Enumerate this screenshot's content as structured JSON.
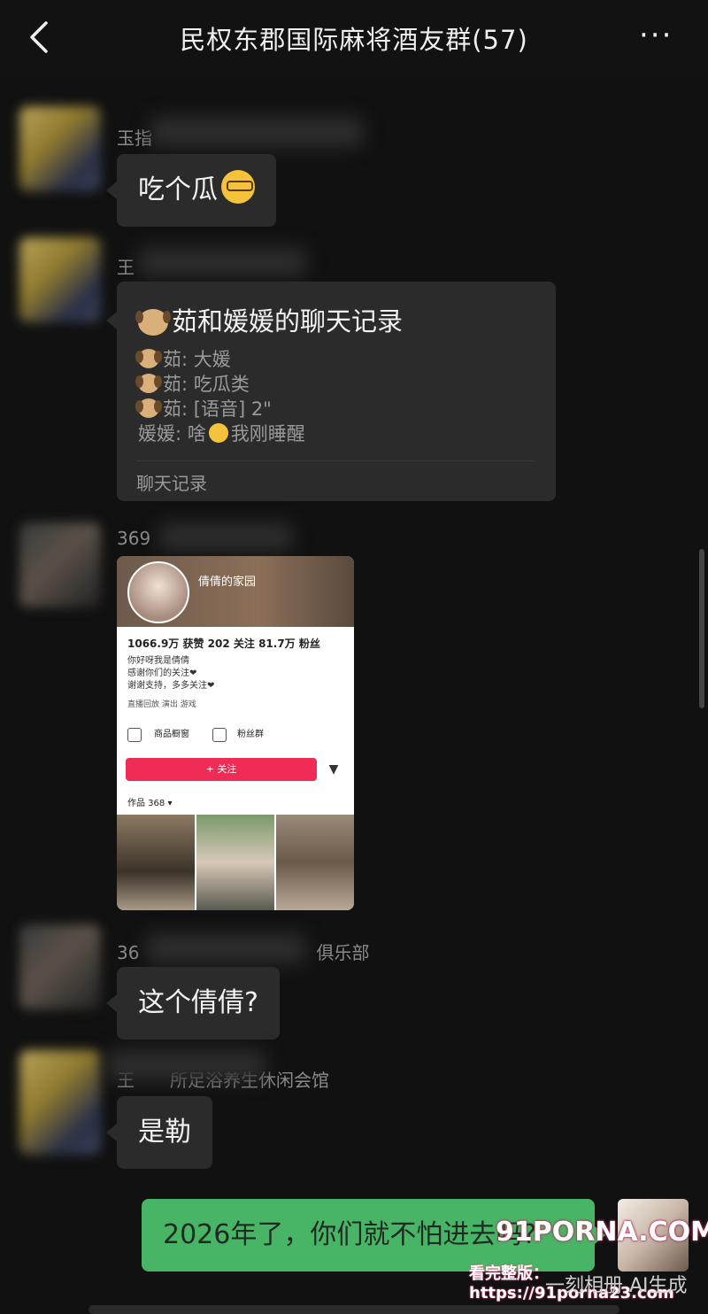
{
  "header": {
    "title": "民权东郡国际麻将酒友群(57)",
    "back_icon": "chevron-left-icon",
    "more_icon": "more-dots-icon",
    "more_label": "···"
  },
  "messages": [
    {
      "sender": "玉指",
      "text": "吃个瓜"
    },
    {
      "sender": "王"
    },
    {
      "sender": "369"
    },
    {
      "sender": "36",
      "sender_suffix": "俱乐部",
      "text": "这个倩倩?"
    },
    {
      "sender": "王",
      "sender_suffix": "所足浴养生休闲会馆",
      "text": "是勒"
    }
  ],
  "chat_record": {
    "title": "茹和媛媛的聊天记录",
    "lines": [
      {
        "who": "茹",
        "text": "大媛"
      },
      {
        "who": "茹",
        "text": "吃瓜类"
      },
      {
        "who": "茹",
        "text": "[语音] 2\""
      },
      {
        "who": "媛媛",
        "pre": "啥",
        "post": "我刚睡醒"
      }
    ],
    "footer": "聊天记录"
  },
  "share_card": {
    "name": "倩倩的家园",
    "stats": "1066.9万 获赞   202 关注   81.7万 粉丝",
    "bio": [
      "你好呀我是倩倩",
      "感谢你们的关注❤",
      "谢谢支持，多多关注❤"
    ],
    "tags": "直播回放    演出    游戏",
    "btn1": "商品橱窗",
    "btn2": "粉丝群",
    "follow": "+ 关注",
    "works": "作品 368 ▾"
  },
  "my_message": {
    "text": "2026年了，你们就不怕进去吗?"
  },
  "watermark": {
    "logo": "91PORNA.COM",
    "line": "看完整版：https://91porna23.com",
    "ai": "一刻相册 AI生成"
  }
}
